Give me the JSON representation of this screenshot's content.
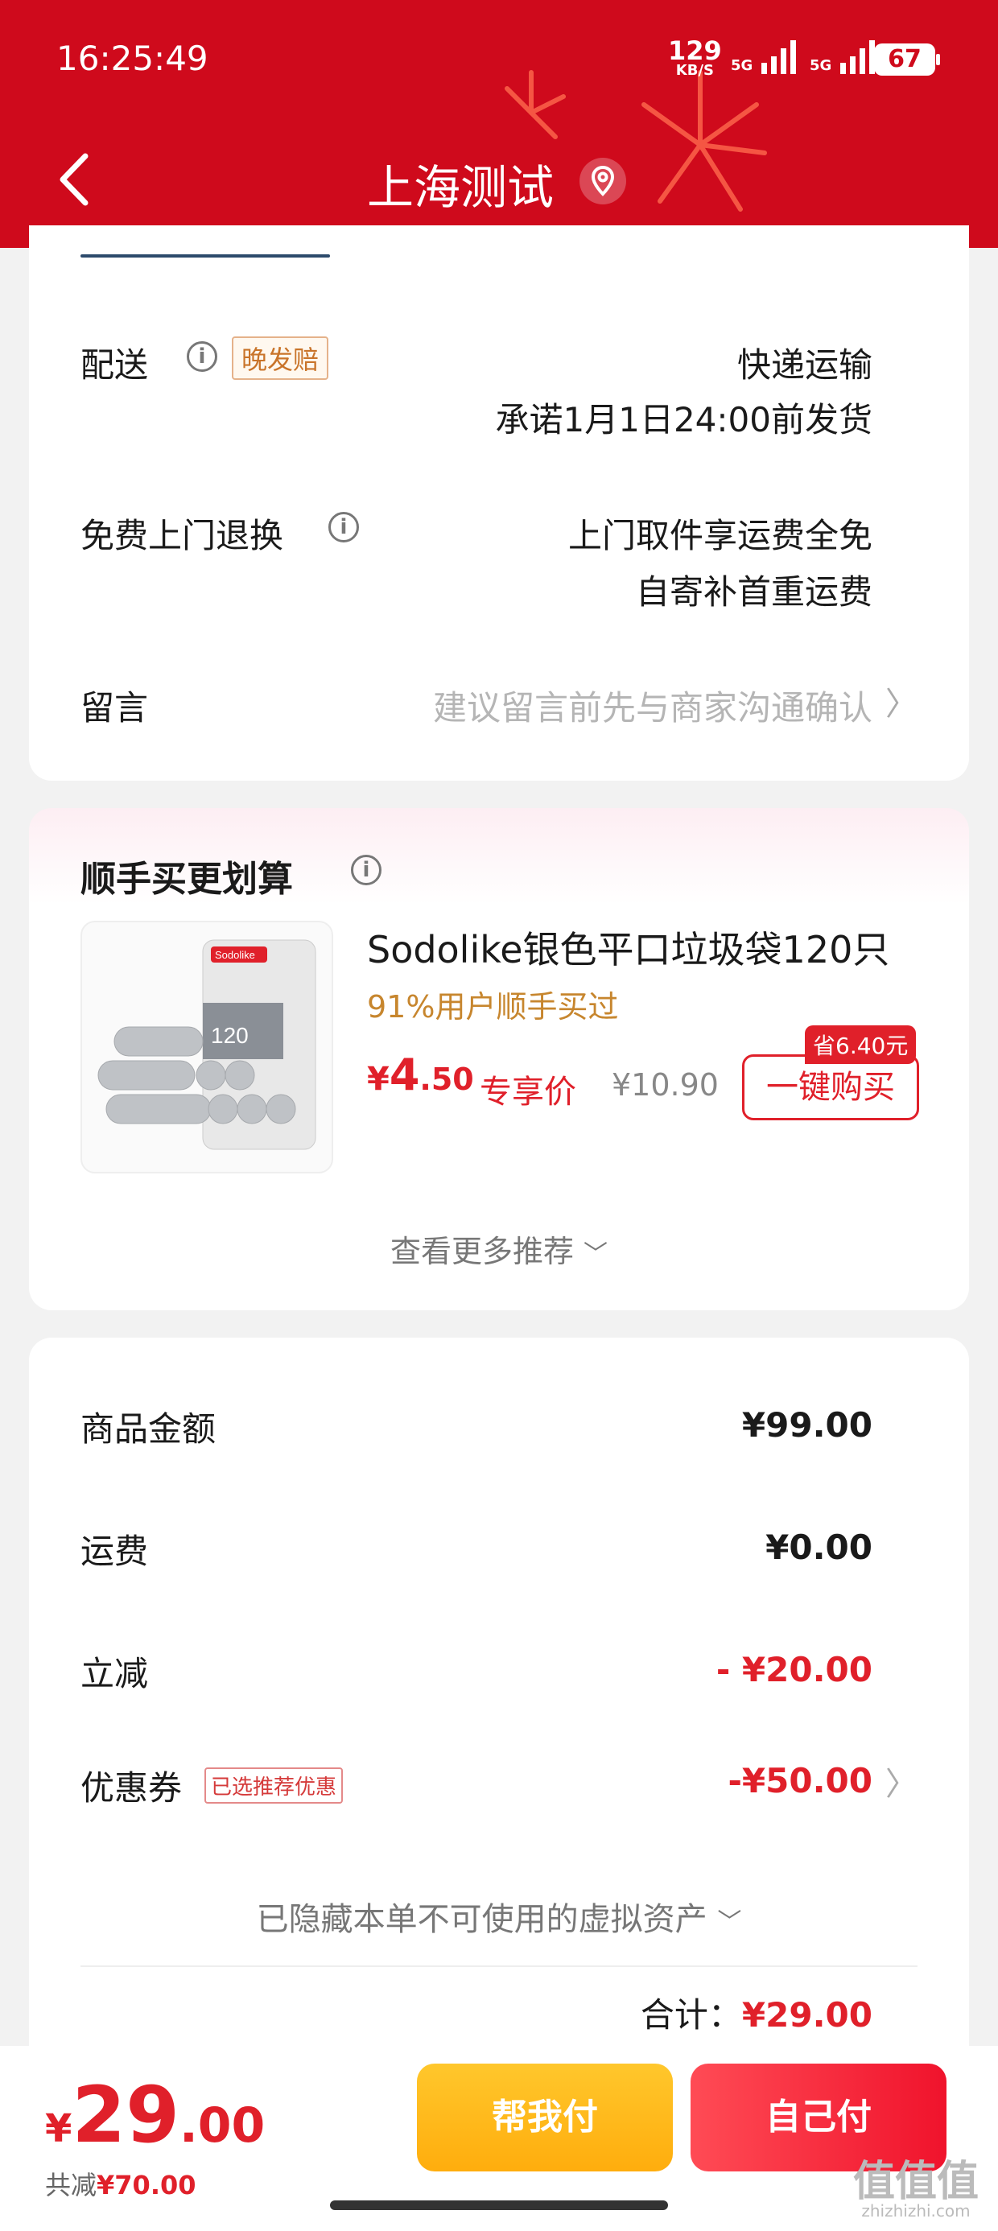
{
  "status_bar": {
    "time": "16:25:49",
    "net_speed": "129",
    "net_unit": "KB/S",
    "signal1_label": "5G",
    "signal2_label": "5G",
    "battery": "67"
  },
  "header": {
    "title": "上海测试",
    "back_icon": "chevron-left-icon",
    "location_icon": "location-pin-icon"
  },
  "delivery": {
    "label": "配送",
    "badge": "晚发赔",
    "value_line1": "快递运输",
    "value_line2": "承诺1月1日24:00前发货"
  },
  "return_service": {
    "label": "免费上门退换",
    "value_line1": "上门取件享运费全免",
    "value_line2": "自寄补首重运费"
  },
  "message": {
    "label": "留言",
    "placeholder": "建议留言前先与商家沟通确认"
  },
  "recommend": {
    "title": "顺手买更划算",
    "product": {
      "name": "Sodolike银色平口垃圾袋120只",
      "social_proof": "91%用户顺手买过",
      "price_symbol": "¥",
      "price_int": "4",
      "price_dec": ".50",
      "exclusive_label": "专享价",
      "original_price": "¥10.90",
      "save_tag": "省6.40元",
      "buy_label": "一键购买",
      "image_brand": "Sodolike",
      "image_count": "120"
    },
    "more_label": "查看更多推荐"
  },
  "summary": {
    "goods_label": "商品金额",
    "goods_value": "¥99.00",
    "shipping_label": "运费",
    "shipping_value": "¥0.00",
    "discount_label": "立减",
    "discount_value": "- ¥20.00",
    "coupon_label": "优惠券",
    "coupon_tag": "已选推荐优惠",
    "coupon_value": "-¥50.00",
    "hidden_assets": "已隐藏本单不可使用的虚拟资产",
    "total_label": "合计：",
    "total_value": "¥29.00"
  },
  "bottom_bar": {
    "price_symbol": "¥",
    "price_int": "29",
    "price_dec": ".00",
    "saved_label": "共减",
    "saved_value": "¥70.00",
    "help_pay_label": "帮我付",
    "self_pay_label": "自己付"
  },
  "watermark": {
    "text": "值值值",
    "site": "zhizhizhi.com"
  },
  "colors": {
    "header_red": "#cf0a1c",
    "price_red": "#e0202a",
    "gold": "#c7862e",
    "help_pay_yellow": "#ffb81a",
    "self_pay_red": "#f0132c"
  }
}
